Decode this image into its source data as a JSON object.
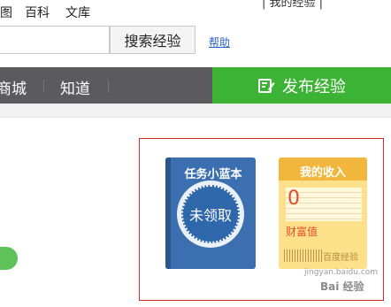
{
  "topnav": {
    "items": [
      "图",
      "百科",
      "文库"
    ],
    "right_text": "| 我的经验 |"
  },
  "search": {
    "button_label": "搜索经验",
    "help_label": "帮助"
  },
  "navbar": {
    "items": [
      "商城",
      "知道"
    ],
    "publish_label": "发布经验"
  },
  "task_book": {
    "title": "任务小蓝本",
    "status": "未领取"
  },
  "income_card": {
    "title": "我的收入",
    "value": "0",
    "caption": "财富值",
    "brand": "百度经验"
  },
  "watermark": {
    "line1": "jingyan.baidu.com",
    "line2": "Bai 经验"
  },
  "colors": {
    "navbar": "#5a5a5f",
    "publish": "#3db335",
    "book": "#3b6fb0",
    "card": "#fde08a",
    "highlight": "#d92b2b"
  }
}
